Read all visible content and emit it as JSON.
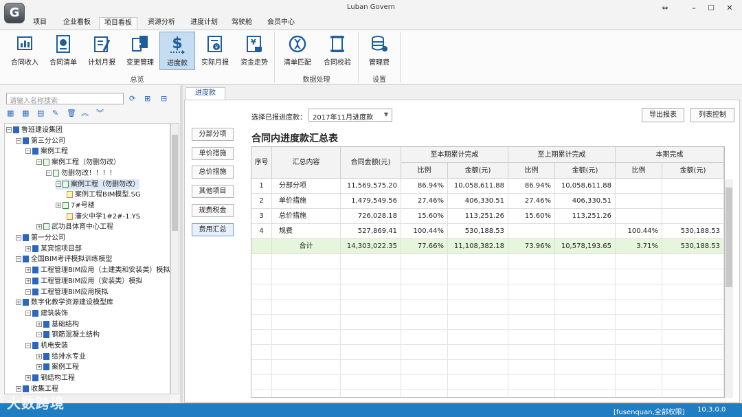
{
  "app": {
    "title": "Luban Govern",
    "logo_letter": "G",
    "window_controls": {
      "restore": "⇔",
      "minimize": "–",
      "maximize": "☐",
      "close": "✕"
    }
  },
  "menu_tabs": [
    "项目",
    "企业看板",
    "项目看板",
    "资源分析",
    "进度计划",
    "驾驶舱",
    "会员中心"
  ],
  "active_menu_tab": "项目看板",
  "ribbon": {
    "buttons": [
      {
        "label": "合同收入",
        "icon": "chart-icon"
      },
      {
        "label": "合同清单",
        "icon": "contract-list-icon"
      },
      {
        "label": "计划月报",
        "icon": "plan-report-icon"
      },
      {
        "label": "变更管理",
        "icon": "change-icon"
      },
      {
        "label": "进度款",
        "icon": "dollar-icon"
      },
      {
        "label": "实际月报",
        "icon": "actual-report-icon"
      },
      {
        "label": "资金走势",
        "icon": "fund-trend-icon"
      },
      {
        "label": "清单匹配",
        "icon": "dna-icon"
      },
      {
        "label": "合同校验",
        "icon": "scroll-icon"
      },
      {
        "label": "管理费",
        "icon": "coins-icon"
      }
    ],
    "active_button": "进度款",
    "groups": [
      "总览",
      "数据处理",
      "设置"
    ]
  },
  "left_panel": {
    "search_placeholder": "请输入名称搜索",
    "tree": [
      {
        "label": "鲁班建设集团",
        "level": 0,
        "icon": "b"
      },
      {
        "label": "第三分公司",
        "level": 1,
        "icon": "b"
      },
      {
        "label": "案例工程",
        "level": 2,
        "icon": "b"
      },
      {
        "label": "案例工程（勿删勿改）",
        "level": 3,
        "icon": "g"
      },
      {
        "label": "勿删勿改！！！！",
        "level": 4,
        "icon": "g"
      },
      {
        "label": "案例工程（勿删勿改）",
        "level": 5,
        "icon": "g",
        "selected": true
      },
      {
        "label": "案例工程BIM模型.SG",
        "level": 6,
        "icon": "y"
      },
      {
        "label": "7#号楼",
        "level": 5,
        "icon": "g"
      },
      {
        "label": "瀋火中学1#2#-1.YS",
        "level": 6,
        "icon": "y"
      },
      {
        "label": "武功县体育中心工程",
        "level": 3,
        "icon": "g"
      },
      {
        "label": "第一分公司",
        "level": 1,
        "icon": "b"
      },
      {
        "label": "某宾馆项目部",
        "level": 2,
        "icon": "b"
      },
      {
        "label": "全国BIM考评模拟训练模型",
        "level": 1,
        "icon": "b"
      },
      {
        "label": "工程管理BIM应用（土建类和安装类）模拟",
        "level": 2,
        "icon": "b"
      },
      {
        "label": "工程管理BIM应用（安装类）模拟",
        "level": 2,
        "icon": "b"
      },
      {
        "label": "工程管理BIM应用模拟",
        "level": 2,
        "icon": "b"
      },
      {
        "label": "数字化教学资源建设模型库",
        "level": 1,
        "icon": "b"
      },
      {
        "label": "建筑装饰",
        "level": 2,
        "icon": "b"
      },
      {
        "label": "基础结构",
        "level": 3,
        "icon": "b"
      },
      {
        "label": "钢筋混凝土结构",
        "level": 3,
        "icon": "b"
      },
      {
        "label": "机电安装",
        "level": 2,
        "icon": "b"
      },
      {
        "label": "给排水专业",
        "level": 3,
        "icon": "b"
      },
      {
        "label": "案例工程",
        "level": 3,
        "icon": "b"
      },
      {
        "label": "钢结构工程",
        "level": 2,
        "icon": "b"
      },
      {
        "label": "收集工程",
        "level": 1,
        "icon": "b"
      }
    ]
  },
  "content": {
    "tab_label": "进度款",
    "period_label": "选择已报进度款：",
    "period_value": "2017年11月进度款",
    "export_label": "导出报表",
    "column_control_label": "列表控制",
    "side_buttons": [
      "分部分项",
      "单价措施",
      "总价措施",
      "其他项目",
      "规费税金",
      "费用汇总"
    ],
    "active_side_button": "费用汇总",
    "report_title": "合同内进度款汇总表",
    "table": {
      "headers": {
        "seq": "序号",
        "content": "汇总内容",
        "amount": "合同金额(元)",
        "cum_current": "至本期累计完成",
        "cum_previous": "至上期累计完成",
        "this_period": "本期完成",
        "ratio": "比例",
        "money": "金额(元)"
      },
      "rows": [
        {
          "seq": "1",
          "name": "分部分项",
          "amount": "11,569,575.20",
          "cur_ratio": "86.94%",
          "cur_amount": "10,058,611.88",
          "prev_ratio": "86.94%",
          "prev_amount": "10,058,611.88",
          "this_ratio": "",
          "this_amount": ""
        },
        {
          "seq": "2",
          "name": "单价措施",
          "amount": "1,479,549.56",
          "cur_ratio": "27.46%",
          "cur_amount": "406,330.51",
          "prev_ratio": "27.46%",
          "prev_amount": "406,330.51",
          "this_ratio": "",
          "this_amount": ""
        },
        {
          "seq": "3",
          "name": "总价措施",
          "amount": "726,028.18",
          "cur_ratio": "15.60%",
          "cur_amount": "113,251.26",
          "prev_ratio": "15.60%",
          "prev_amount": "113,251.26",
          "this_ratio": "",
          "this_amount": ""
        },
        {
          "seq": "4",
          "name": "规费",
          "amount": "527,869.41",
          "cur_ratio": "100.44%",
          "cur_amount": "530,188.53",
          "prev_ratio": "",
          "prev_amount": "",
          "this_ratio": "100.44%",
          "this_amount": "530,188.53"
        }
      ],
      "total": {
        "seq": "",
        "name": "合计",
        "amount": "14,303,022.35",
        "cur_ratio": "77.66%",
        "cur_amount": "11,108,382.18",
        "prev_ratio": "73.96%",
        "prev_amount": "10,578,193.65",
        "this_ratio": "3.71%",
        "this_amount": "530,188.53"
      }
    }
  },
  "status": {
    "user": "[fusenquan,全部权限]",
    "version": "10.3.0.0",
    "watermark": "大数跨境"
  },
  "colors": {
    "accent": "#1f7dc2",
    "selected": "#c5dcf2",
    "total_row": "#e6f6dc"
  }
}
